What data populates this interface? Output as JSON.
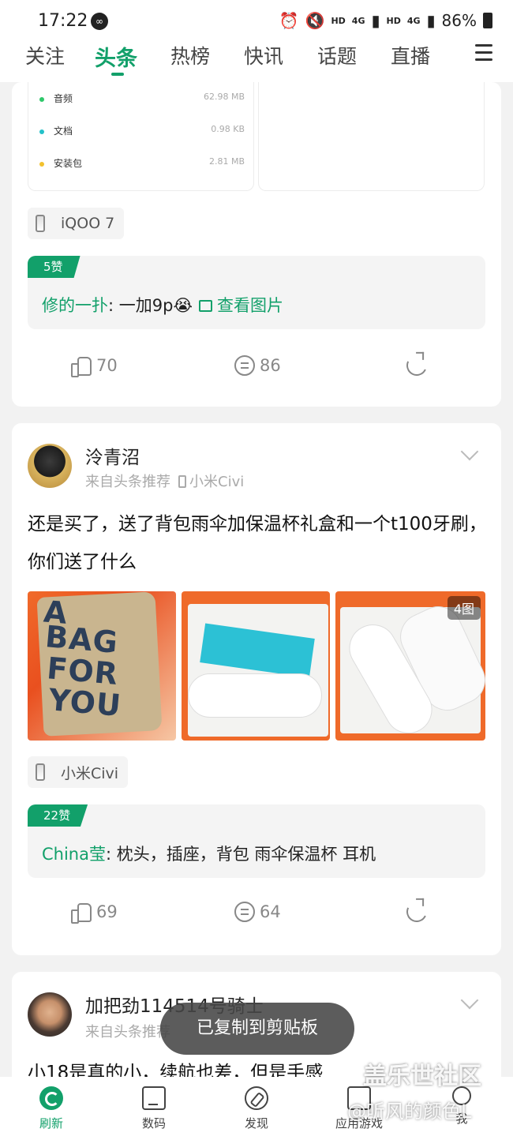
{
  "status_bar": {
    "time": "17:22",
    "net_labels": [
      "HD",
      "4G",
      "HD",
      "4G"
    ],
    "battery": "86%"
  },
  "top_nav": {
    "tabs": [
      "关注",
      "头条",
      "热榜",
      "快讯",
      "话题",
      "直播"
    ],
    "active_tab": "头条",
    "accent_color": "#12a06a"
  },
  "post1": {
    "storage_rows": [
      {
        "name": "音频",
        "size": "62.98 MB",
        "dot_color": "#2ec86a"
      },
      {
        "name": "文档",
        "size": "0.98 KB",
        "dot_color": "#23c1c9"
      },
      {
        "name": "安装包",
        "size": "2.81 MB",
        "dot_color": "#f2c12e"
      }
    ],
    "device": "iQOO 7",
    "hot_comment": {
      "likes": "5赞",
      "user": "修的一扑",
      "text": ": 一加9p😭",
      "view_image": "查看图片"
    },
    "actions": {
      "likes": "70",
      "comments": "86"
    }
  },
  "post2": {
    "author": "泠青沼",
    "source": "来自头条推荐",
    "source_device": "小米Civi",
    "content": "还是买了，送了背包雨伞加保温杯礼盒和一个t100牙刷，你们送了什么",
    "image_count": "4图",
    "bag_words": [
      "A",
      "BAG",
      "FOR",
      "YOU"
    ],
    "device": "小米Civi",
    "hot_comment": {
      "likes": "22赞",
      "user": "China莹",
      "text": ": 枕头，插座，背包 雨伞保温杯 耳机"
    },
    "actions": {
      "likes": "69",
      "comments": "64"
    }
  },
  "post3": {
    "author": "加把劲114514号骑士",
    "source": "来自头条推荐",
    "content": "小18是真的小，续航也差，但是手感"
  },
  "toast": "已复制到剪贴板",
  "bottom_nav": {
    "items": [
      "刷新",
      "数码",
      "发现",
      "应用游戏",
      "我"
    ],
    "active": "刷新"
  },
  "watermark": {
    "line1": "盖乐世社区",
    "line2": "@听风的颜色L"
  }
}
